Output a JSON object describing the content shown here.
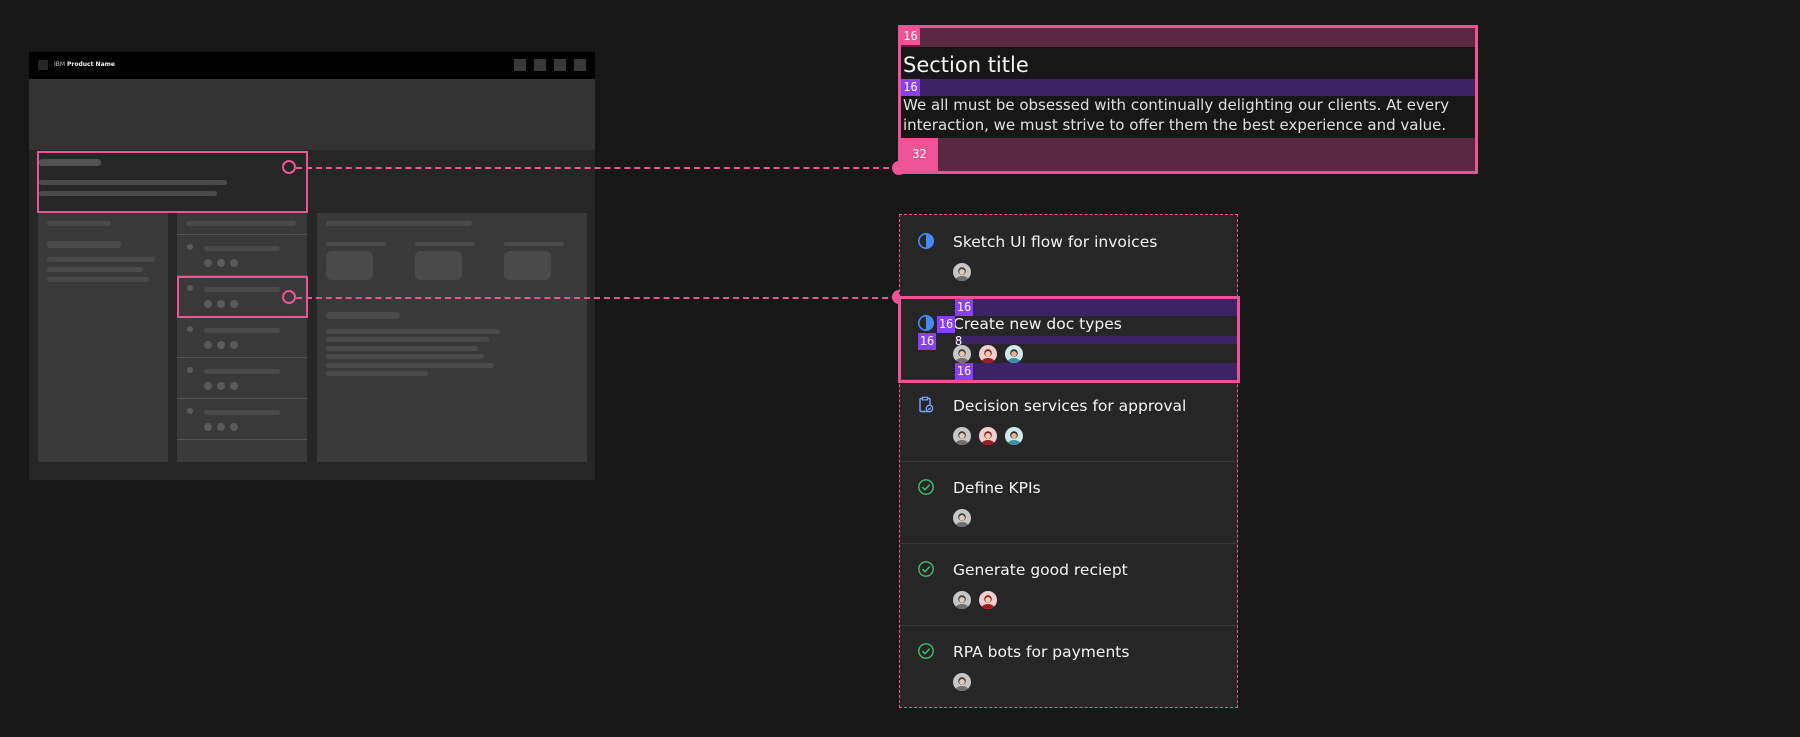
{
  "thumbnail": {
    "header_brand": "IBM",
    "header_product": "Product Name"
  },
  "section": {
    "title": "Section title",
    "body": "We all must be obsessed with continually delighting our clients. At every interaction, we must strive to offer them the best experience and value.",
    "spacing": {
      "top": "16",
      "title_gap": "16",
      "bottom": "32"
    }
  },
  "tasks": [
    {
      "label": "Sketch UI flow for invoices",
      "status": "in-progress-icon",
      "avatars": [
        "avatar-gray"
      ]
    },
    {
      "label": "Create new doc types",
      "status": "in-progress-icon",
      "avatars": [
        "avatar-gray",
        "avatar-red",
        "avatar-teal"
      ]
    },
    {
      "label": "Decision services for approval",
      "status": "clipboard-icon",
      "avatars": [
        "avatar-gray",
        "avatar-red",
        "avatar-teal"
      ]
    },
    {
      "label": "Define KPIs",
      "status": "checkmark-icon",
      "avatars": [
        "avatar-gray"
      ]
    },
    {
      "label": "Generate good reciept",
      "status": "checkmark-icon",
      "avatars": [
        "avatar-gray",
        "avatar-red"
      ]
    },
    {
      "label": "RPA bots for payments",
      "status": "checkmark-icon",
      "avatars": [
        "avatar-gray"
      ]
    }
  ],
  "task_spacing": {
    "top": "16",
    "icon_gap": "16",
    "left": "16",
    "avatar_gap": "8",
    "bottom": "16"
  },
  "colors": {
    "accent_pink": "#ee5396",
    "accent_purple": "#8a3ffc",
    "in_progress_blue": "#4589ff",
    "success_green": "#42be65",
    "background": "#171717",
    "surface": "#262626"
  }
}
